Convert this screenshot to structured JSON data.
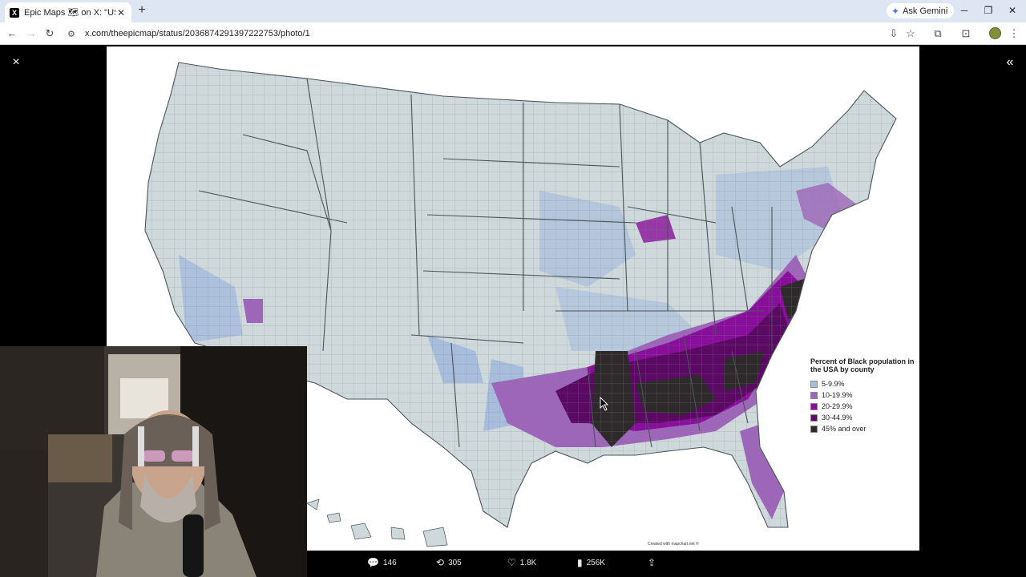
{
  "browser": {
    "tab_title": "Epic Maps 🗺 on X: \"USA black",
    "tab_favicon": "X",
    "new_tab": "+",
    "ask_gemini": "Ask Gemini",
    "url": "x.com/theepicmap/status/2036874291397222753/photo/1"
  },
  "viewer": {
    "close_icon": "×",
    "collapse_icon": "«"
  },
  "map": {
    "legend_title": "Percent of Black population in the USA by county",
    "legend": [
      {
        "label": "5-9.9%",
        "color": "#a8bcdc"
      },
      {
        "label": "10-19.9%",
        "color": "#9e66b8"
      },
      {
        "label": "20-29.9%",
        "color": "#880f9a"
      },
      {
        "label": "30-44.9%",
        "color": "#5a0a62"
      },
      {
        "label": "45% and over",
        "color": "#2e2a2c"
      }
    ],
    "credit": "Created with mapchart.net ©",
    "base_color": "#cfd9dc"
  },
  "actions": {
    "replies": "146",
    "reposts": "305",
    "likes": "1.8K",
    "views": "256K"
  }
}
